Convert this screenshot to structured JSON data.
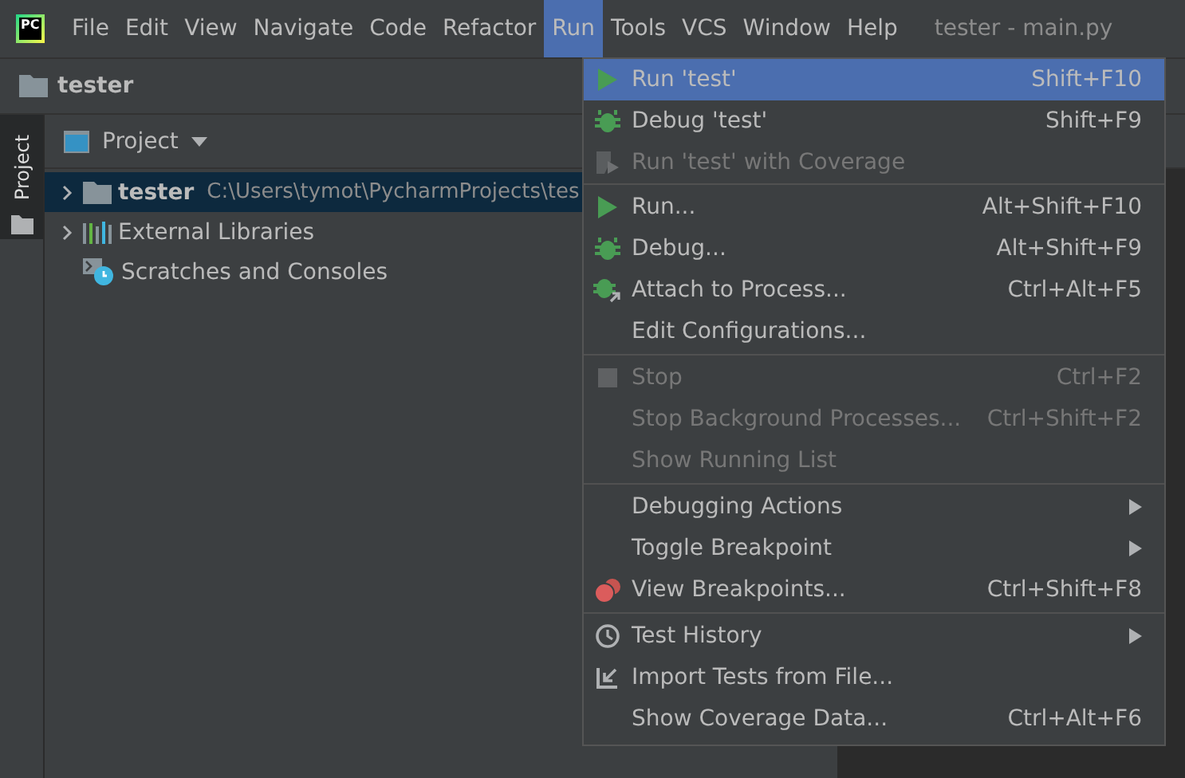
{
  "menu_bar": {
    "logo": "PC",
    "items": [
      {
        "label": "File",
        "selected": false
      },
      {
        "label": "Edit",
        "selected": false
      },
      {
        "label": "View",
        "selected": false
      },
      {
        "label": "Navigate",
        "selected": false
      },
      {
        "label": "Code",
        "selected": false
      },
      {
        "label": "Refactor",
        "selected": false
      },
      {
        "label": "Run",
        "selected": true
      },
      {
        "label": "Tools",
        "selected": false
      },
      {
        "label": "VCS",
        "selected": false
      },
      {
        "label": "Window",
        "selected": false
      },
      {
        "label": "Help",
        "selected": false
      }
    ],
    "window_title": "tester - main.py"
  },
  "breadcrumb": {
    "label": "tester"
  },
  "side_tab": {
    "label": "Project",
    "selected": true
  },
  "project_panel": {
    "title": "Project",
    "tree": [
      {
        "kind": "folder",
        "label": "tester",
        "path": "C:\\Users\\tymot\\PycharmProjects\\tes",
        "expanded": false,
        "selected": true
      },
      {
        "kind": "libraries",
        "label": "External Libraries",
        "expanded": false,
        "selected": false
      },
      {
        "kind": "scratches",
        "label": "Scratches and Consoles",
        "selected": false
      }
    ]
  },
  "run_menu": {
    "groups": [
      [
        {
          "kind": "run",
          "label": "Run 'test'",
          "shortcut": "Shift+F10",
          "disabled": false,
          "selected": true
        },
        {
          "kind": "debug",
          "label": "Debug 'test'",
          "shortcut": "Shift+F9",
          "disabled": false,
          "selected": false
        },
        {
          "kind": "coverage",
          "label": "Run 'test' with Coverage",
          "disabled": true,
          "selected": false
        }
      ],
      [
        {
          "kind": "run",
          "label": "Run...",
          "shortcut": "Alt+Shift+F10",
          "disabled": false,
          "selected": false
        },
        {
          "kind": "debug",
          "label": "Debug...",
          "shortcut": "Alt+Shift+F9",
          "disabled": false,
          "selected": false
        },
        {
          "kind": "attach",
          "label": "Attach to Process...",
          "shortcut": "Ctrl+Alt+F5",
          "disabled": false,
          "selected": false
        },
        {
          "label": "Edit Configurations...",
          "disabled": false,
          "selected": false
        }
      ],
      [
        {
          "kind": "stop",
          "label": "Stop",
          "shortcut": "Ctrl+F2",
          "disabled": true,
          "selected": false
        },
        {
          "label": "Stop Background Processes...",
          "shortcut": "Ctrl+Shift+F2",
          "disabled": true,
          "selected": false
        },
        {
          "label": "Show Running List",
          "disabled": true,
          "selected": false
        }
      ],
      [
        {
          "label": "Debugging Actions",
          "submenu": true,
          "disabled": false,
          "selected": false
        },
        {
          "label": "Toggle Breakpoint",
          "submenu": true,
          "disabled": false,
          "selected": false
        },
        {
          "kind": "breakpoints",
          "label": "View Breakpoints...",
          "shortcut": "Ctrl+Shift+F8",
          "disabled": false,
          "selected": false
        }
      ],
      [
        {
          "kind": "history",
          "label": "Test History",
          "submenu": true,
          "disabled": false,
          "selected": false
        },
        {
          "kind": "import",
          "label": "Import Tests from File...",
          "disabled": false,
          "selected": false
        },
        {
          "label": "Show Coverage Data...",
          "shortcut": "Ctrl+Alt+F6",
          "disabled": false,
          "selected": false
        }
      ]
    ]
  }
}
